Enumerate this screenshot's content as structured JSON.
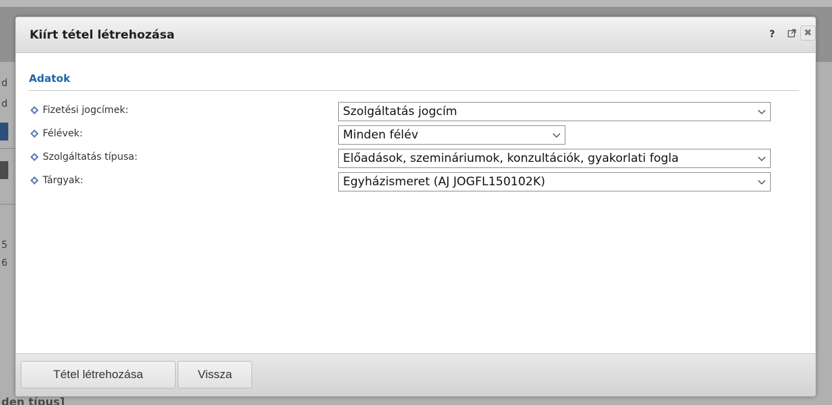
{
  "background": {
    "fragments": [
      "d",
      "d",
      "5",
      "6"
    ],
    "bottom_text": "den típus]"
  },
  "dialog": {
    "title": "Kiírt tétel létrehozása",
    "help_label": "?",
    "close_label": "✖",
    "section_title": "Adatok",
    "fields": [
      {
        "label": "Fizetési jogcímek:",
        "value": "Szolgáltatás jogcím"
      },
      {
        "label": "Félévek:",
        "value": "Minden félév"
      },
      {
        "label": "Szolgáltatás típusa:",
        "value": "Előadások, szemináriumok, konzultációk, gyakorlati fogla"
      },
      {
        "label": "Tárgyak:",
        "value": "Egyházismeret (AJ JOGFL150102K)"
      }
    ],
    "buttons": {
      "create_label": "Tétel létrehozása",
      "back_label": "Vissza"
    }
  },
  "colors": {
    "section_title": "#2266a8",
    "bullet": "#5b7fb5"
  }
}
